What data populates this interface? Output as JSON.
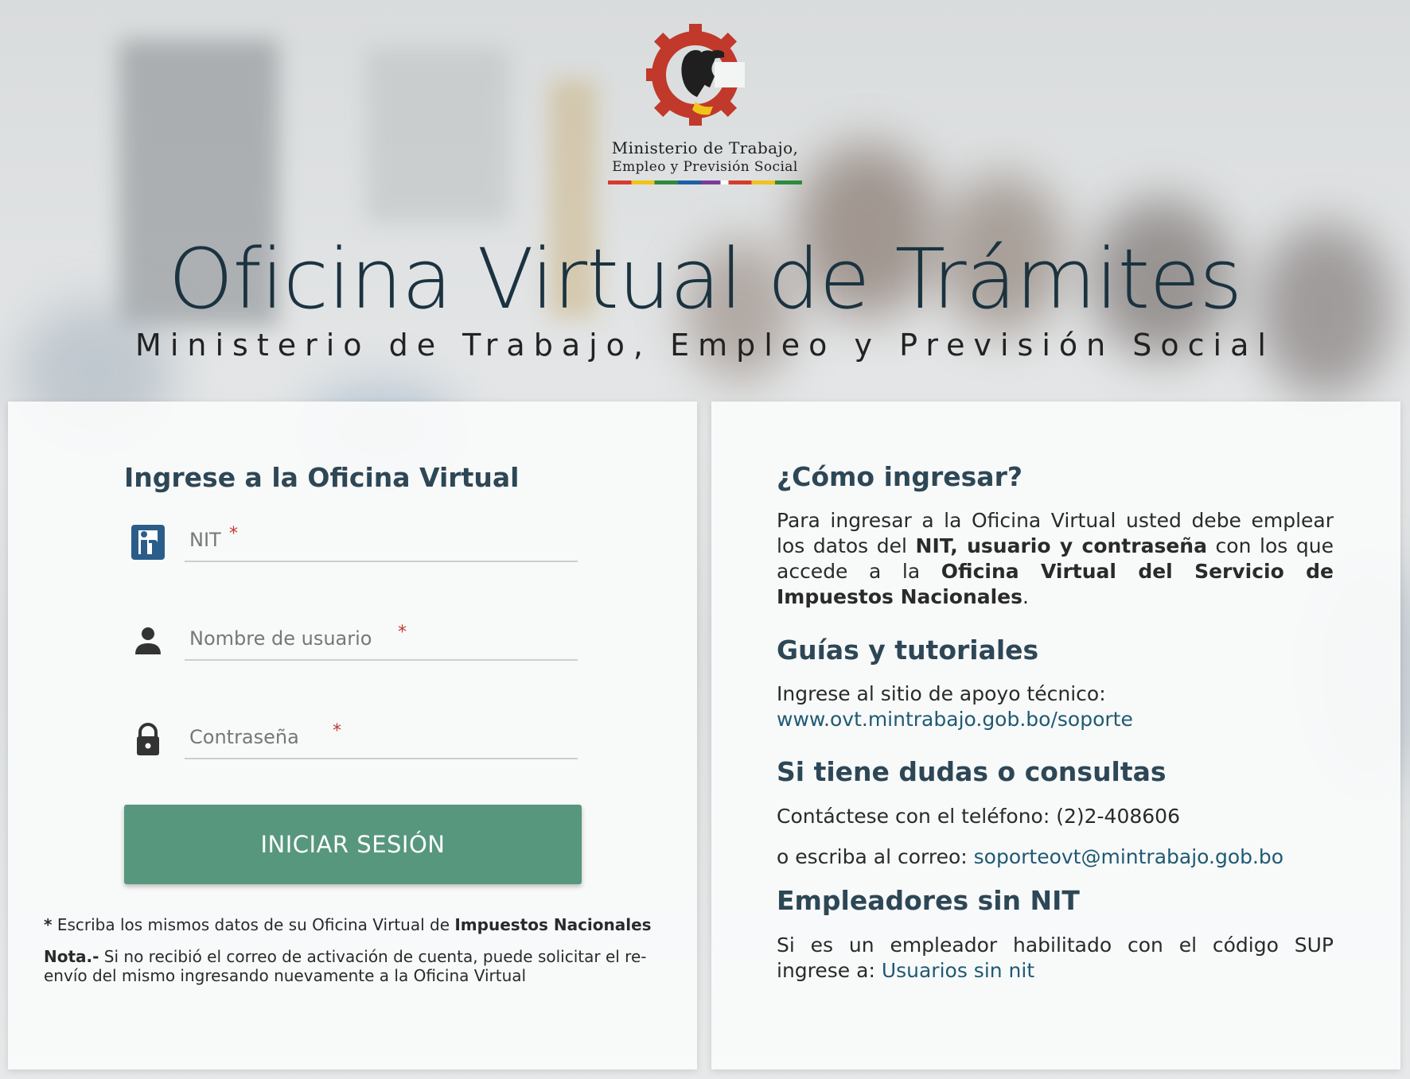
{
  "logo": {
    "line1": "Ministerio de Trabajo,",
    "line2": "Empleo y Previsión Social"
  },
  "header": {
    "title": "Oficina Virtual de Trámites",
    "subtitle": "Ministerio de Trabajo, Empleo y Previsión Social"
  },
  "login": {
    "title": "Ingrese a la Oficina Virtual",
    "fields": [
      {
        "placeholder": "NIT",
        "required_mark": "*",
        "icon": "nit-id-icon",
        "value": ""
      },
      {
        "placeholder": "Nombre de usuario",
        "required_mark": "*",
        "icon": "user-icon",
        "value": ""
      },
      {
        "placeholder": "Contraseña",
        "required_mark": "*",
        "icon": "lock-icon",
        "value": ""
      }
    ],
    "submit_label": "INICIAR SESIÓN",
    "note_star": "*",
    "note_text": " Escriba los mismos datos de su Oficina Virtual de ",
    "note_bold": "Impuestos Nacionales",
    "nota_label": "Nota.-",
    "nota_text": " Si no recibió el correo de activación de cuenta, puede solicitar el re-envío del mismo ingresando nuevamente a la Oficina Virtual"
  },
  "info": {
    "how_title": "¿Cómo ingresar?",
    "how_p1": "Para ingresar a la Oficina Virtual usted debe emplear los datos del ",
    "how_b1": "NIT, usuario y contraseña",
    "how_p2": " con los que accede a la ",
    "how_b2": "Oficina Virtual del Servicio de Impuestos Nacionales",
    "how_p3": ".",
    "guides_title": "Guías y tutoriales",
    "guides_text": "Ingrese al sitio de apoyo técnico:",
    "guides_link": "www.ovt.mintrabajo.gob.bo/soporte",
    "doubts_title": "Si tiene dudas o consultas",
    "phone_text": "Contáctese con el teléfono: (2)2-408606",
    "mail_text": "o escriba al correo: ",
    "mail_link": "soporteovt@mintrabajo.gob.bo",
    "employers_title": "Empleadores sin NIT",
    "employers_text": "Si es un empleador habilitado con el código SUP ingrese a: ",
    "employers_link": "Usuarios sin nit"
  },
  "colors": {
    "accent_button": "#57977e",
    "heading": "#2d4756",
    "link": "#1f5a73",
    "required": "#c0392b"
  }
}
